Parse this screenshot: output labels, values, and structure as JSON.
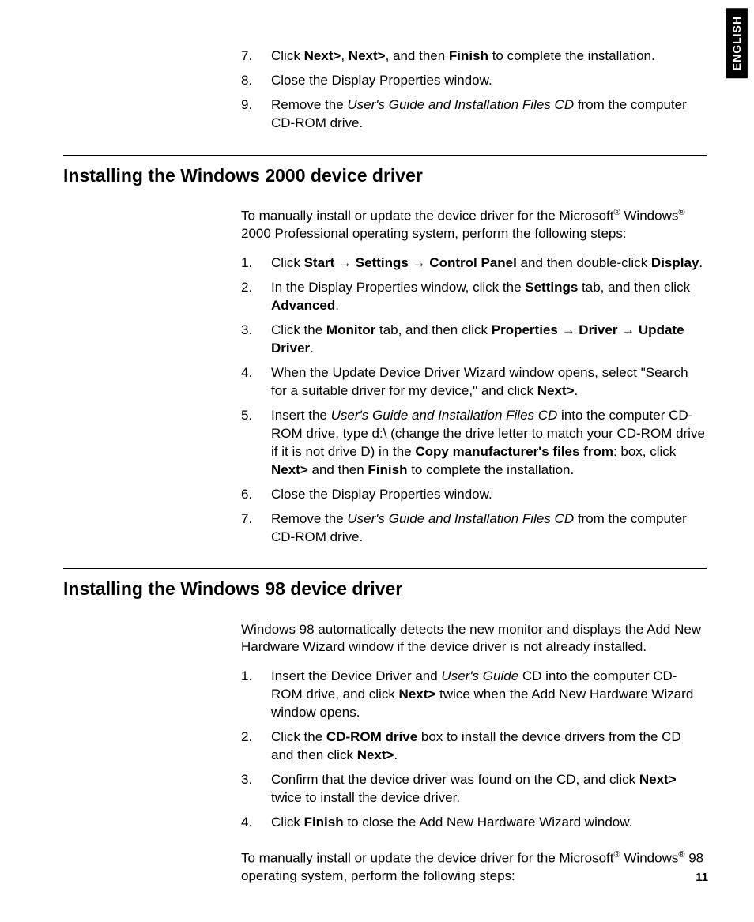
{
  "sideTab": "ENGLISH",
  "pageNumber": "11",
  "topSteps": [
    {
      "n": "7.",
      "html": "Click <b>Next></b>, <b>Next></b>, and then <b>Finish</b> to complete the installation."
    },
    {
      "n": "8.",
      "html": "Close the Display Properties window."
    },
    {
      "n": "9.",
      "html": "Remove the <i>User's Guide and Installation Files CD</i> from the computer CD-ROM drive."
    }
  ],
  "section1": {
    "heading": "Installing the Windows 2000 device driver",
    "intro": "To manually install or update the device driver for the Microsoft<sup>®</sup> Windows<sup>®</sup> 2000 Professional operating system, perform the following steps:",
    "steps": [
      {
        "n": "1.",
        "html": "Click <b>Start</b> <span class='arrow'>→</span> <b>Settings</b> <span class='arrow'>→</span> <b>Control Panel</b> and then double-click <b>Display</b>."
      },
      {
        "n": "2.",
        "html": "In the Display Properties window, click the <b>Settings</b> tab, and then click <b>Advanced</b>."
      },
      {
        "n": "3.",
        "html": "Click the <b>Monitor</b> tab, and then click <b>Properties</b> <span class='arrow'>→</span> <b>Driver</b> <span class='arrow'>→</span> <b>Update Driver</b>."
      },
      {
        "n": "4.",
        "html": "When the Update Device Driver Wizard window opens, select \"Search for a suitable driver for my device,\" and click <b>Next></b>."
      },
      {
        "n": "5.",
        "html": "Insert the <i>User's Guide and Installation Files CD</i> into the computer CD-ROM drive, type d:\\ (change the drive letter to match your CD-ROM drive if it is not drive D) in the <b>Copy manufacturer's files from</b>: box, click <b>Next></b> and then <b>Finish</b> to complete the installation."
      },
      {
        "n": "6.",
        "html": "Close the Display Properties window."
      },
      {
        "n": "7.",
        "html": "Remove the <i>User's Guide and Installation Files CD</i> from the computer CD-ROM drive."
      }
    ]
  },
  "section2": {
    "heading": "Installing the Windows 98 device driver",
    "intro": "Windows 98 automatically detects the new monitor and displays the Add New Hardware Wizard window if the device driver is not already installed.",
    "steps": [
      {
        "n": "1.",
        "html": "Insert the Device Driver and <i>User's Guide</i> CD into the computer CD-ROM drive, and click <b>Next></b> twice when the Add New Hardware Wizard window opens."
      },
      {
        "n": "2.",
        "html": "Click the <b>CD-ROM drive</b> box to install the device drivers from the CD and then click <b>Next></b>."
      },
      {
        "n": "3.",
        "html": "Confirm that the device driver was found on the CD, and click <b>Next></b> twice to install the device driver."
      },
      {
        "n": "4.",
        "html": "Click <b>Finish</b> to close the Add New Hardware Wizard window."
      }
    ],
    "outro": "To manually install or update the device driver for the Microsoft<sup>®</sup> Windows<sup>®</sup> 98 operating system, perform the following steps:"
  }
}
